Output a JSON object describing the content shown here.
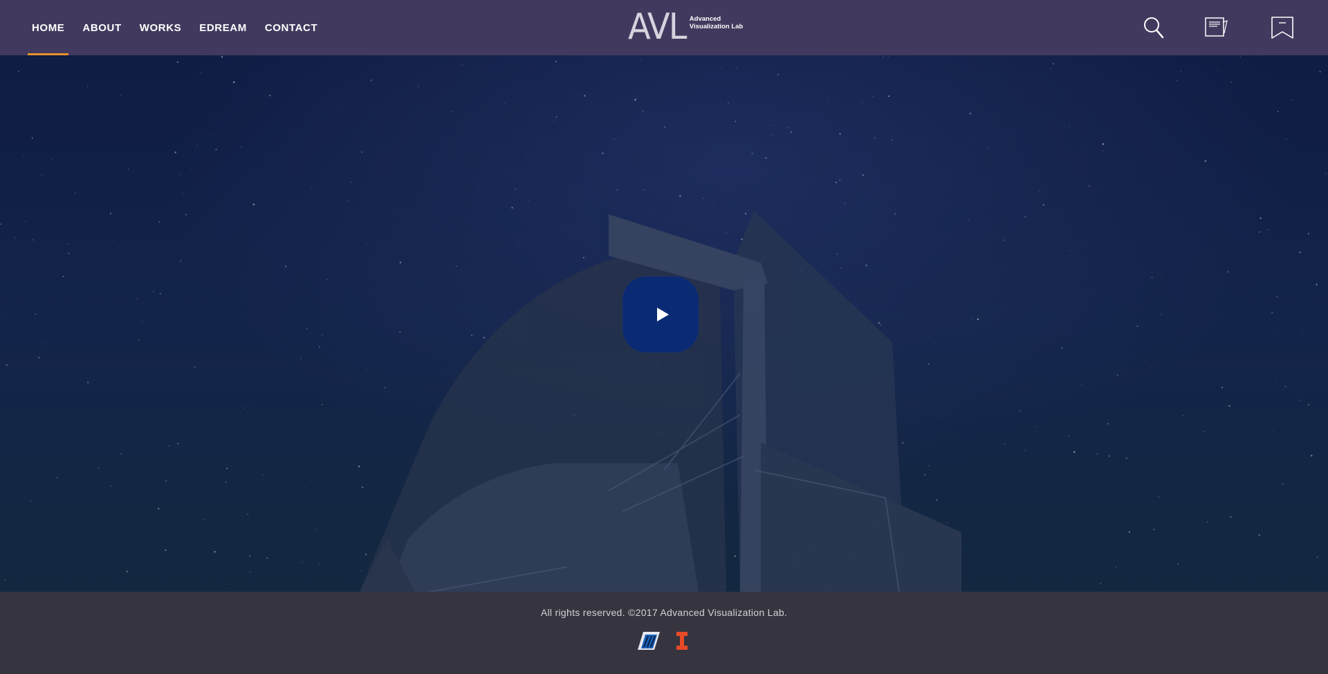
{
  "nav": {
    "items": [
      {
        "label": "HOME",
        "active": true
      },
      {
        "label": "ABOUT"
      },
      {
        "label": "WORKS"
      },
      {
        "label": "EDREAM"
      },
      {
        "label": "CONTACT"
      }
    ]
  },
  "logo": {
    "mark": "AVL",
    "line1": "Advanced",
    "line2": "Visualization Lab"
  },
  "header_icons": [
    "search-icon",
    "notepad-icon",
    "bookmark-icon"
  ],
  "hero": {
    "play_icon": "play-icon"
  },
  "footer": {
    "copyright": "All rights reserved. ©2017 Advanced Visualization Lab.",
    "logos": [
      "ncsa-logo",
      "illinois-logo"
    ]
  },
  "colors": {
    "header": "#423a5e",
    "accent": "#e8922b",
    "hero": "#13244a",
    "play": "#0b2a74",
    "footer": "#36343e",
    "illinois_orange": "#e84a27"
  }
}
